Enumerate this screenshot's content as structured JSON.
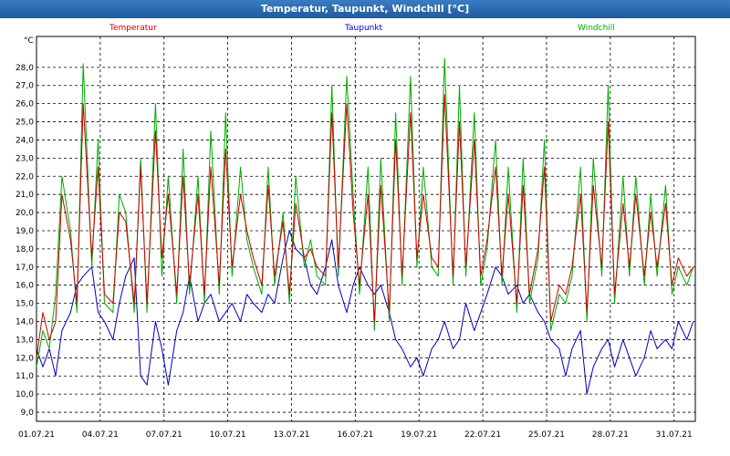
{
  "window": {
    "title": "Temperatur, Taupunkt, Windchill [°C]"
  },
  "colors": {
    "temperatur": "#cc0000",
    "taupunkt": "#0000bb",
    "windchill": "#00aa00",
    "grid": "#000000",
    "title_bar": "#2b6cb0"
  },
  "chart_data": {
    "type": "line",
    "title": "Temperatur, Taupunkt, Windchill [°C]",
    "ylabel": "°C",
    "xlabel": "",
    "ylim": [
      8.5,
      29.7
    ],
    "xlim": [
      1.0,
      32.0
    ],
    "y_ticks": [
      "9,0",
      "10,0",
      "11,0",
      "12,0",
      "13,0",
      "14,0",
      "15,0",
      "16,0",
      "17,0",
      "18,0",
      "19,0",
      "20,0",
      "21,0",
      "22,0",
      "23,0",
      "24,0",
      "25,0",
      "26,0",
      "27,0",
      "28,0"
    ],
    "x_ticks": [
      {
        "label": "01.07.21",
        "day": 1
      },
      {
        "label": "04.07.21",
        "day": 4
      },
      {
        "label": "07.07.21",
        "day": 7
      },
      {
        "label": "10.07.21",
        "day": 10
      },
      {
        "label": "13.07.21",
        "day": 13
      },
      {
        "label": "16.07.21",
        "day": 16
      },
      {
        "label": "19.07.21",
        "day": 19
      },
      {
        "label": "22.07.21",
        "day": 22
      },
      {
        "label": "25.07.21",
        "day": 25
      },
      {
        "label": "28.07.21",
        "day": 28
      },
      {
        "label": "31.07.21",
        "day": 31
      }
    ],
    "grid": true,
    "legend_position": "top",
    "x_unit": "day of July 2021",
    "series": [
      {
        "name": "Temperatur",
        "color": "#cc0000",
        "x": [
          1.0,
          1.3,
          1.6,
          1.9,
          2.2,
          2.6,
          2.9,
          3.2,
          3.6,
          3.9,
          4.2,
          4.6,
          4.9,
          5.2,
          5.6,
          5.9,
          6.2,
          6.6,
          6.9,
          7.2,
          7.6,
          7.9,
          8.2,
          8.6,
          8.9,
          9.2,
          9.6,
          9.9,
          10.2,
          10.6,
          10.9,
          11.2,
          11.6,
          11.9,
          12.2,
          12.6,
          12.9,
          13.2,
          13.6,
          13.9,
          14.2,
          14.6,
          14.9,
          15.2,
          15.6,
          15.9,
          16.2,
          16.6,
          16.9,
          17.2,
          17.6,
          17.9,
          18.2,
          18.6,
          18.9,
          19.2,
          19.6,
          19.9,
          20.2,
          20.6,
          20.9,
          21.2,
          21.6,
          21.9,
          22.2,
          22.6,
          22.9,
          23.2,
          23.6,
          23.9,
          24.2,
          24.6,
          24.9,
          25.2,
          25.6,
          25.9,
          26.2,
          26.6,
          26.9,
          27.2,
          27.6,
          27.9,
          28.2,
          28.6,
          28.9,
          29.2,
          29.6,
          29.9,
          30.2,
          30.6,
          30.9,
          31.2,
          31.6,
          31.9
        ],
        "values": [
          12.0,
          14.5,
          13.0,
          14.0,
          21.0,
          18.5,
          15.0,
          26.0,
          17.5,
          22.5,
          15.5,
          15.0,
          20.0,
          19.5,
          15.0,
          22.5,
          15.0,
          24.5,
          17.5,
          21.0,
          15.5,
          22.0,
          16.0,
          21.0,
          15.5,
          22.5,
          16.0,
          23.5,
          17.0,
          21.0,
          19.0,
          17.5,
          16.0,
          21.5,
          16.5,
          19.5,
          15.5,
          20.5,
          17.5,
          18.0,
          17.0,
          16.5,
          25.5,
          17.0,
          26.0,
          20.0,
          16.0,
          21.0,
          14.0,
          21.5,
          14.5,
          24.0,
          16.5,
          25.5,
          17.5,
          21.0,
          17.5,
          17.0,
          26.5,
          16.5,
          25.0,
          17.0,
          24.0,
          16.5,
          18.5,
          22.5,
          16.5,
          21.0,
          15.0,
          21.5,
          15.5,
          18.0,
          22.5,
          14.0,
          16.0,
          15.5,
          17.0,
          21.0,
          14.5,
          21.5,
          17.0,
          25.0,
          15.5,
          20.5,
          17.0,
          21.0,
          16.5,
          20.0,
          17.0,
          20.5,
          16.0,
          17.5,
          16.5,
          17.0
        ]
      },
      {
        "name": "Taupunkt",
        "color": "#0000bb",
        "x": [
          1.0,
          1.3,
          1.6,
          1.9,
          2.2,
          2.6,
          2.9,
          3.2,
          3.6,
          3.9,
          4.2,
          4.6,
          4.9,
          5.2,
          5.6,
          5.9,
          6.2,
          6.6,
          6.9,
          7.2,
          7.6,
          7.9,
          8.2,
          8.6,
          8.9,
          9.2,
          9.6,
          9.9,
          10.2,
          10.6,
          10.9,
          11.2,
          11.6,
          11.9,
          12.2,
          12.6,
          12.9,
          13.2,
          13.6,
          13.9,
          14.2,
          14.6,
          14.9,
          15.2,
          15.6,
          15.9,
          16.2,
          16.6,
          16.9,
          17.2,
          17.6,
          17.9,
          18.2,
          18.6,
          18.9,
          19.2,
          19.6,
          19.9,
          20.2,
          20.6,
          20.9,
          21.2,
          21.6,
          21.9,
          22.2,
          22.6,
          22.9,
          23.2,
          23.6,
          23.9,
          24.2,
          24.6,
          24.9,
          25.2,
          25.6,
          25.9,
          26.2,
          26.6,
          26.9,
          27.2,
          27.6,
          27.9,
          28.2,
          28.6,
          28.9,
          29.2,
          29.6,
          29.9,
          30.2,
          30.6,
          30.9,
          31.2,
          31.6,
          31.9
        ],
        "values": [
          12.5,
          11.5,
          12.5,
          11.0,
          13.5,
          14.5,
          16.0,
          16.5,
          17.0,
          14.5,
          14.0,
          13.0,
          15.0,
          16.5,
          17.5,
          11.0,
          10.5,
          14.0,
          12.5,
          10.5,
          13.5,
          14.5,
          16.5,
          14.0,
          15.0,
          15.5,
          14.0,
          14.5,
          15.0,
          14.0,
          15.5,
          15.0,
          14.5,
          15.5,
          15.0,
          17.5,
          19.0,
          18.0,
          17.5,
          16.0,
          15.5,
          17.0,
          18.5,
          16.0,
          14.5,
          16.0,
          17.0,
          16.0,
          15.5,
          16.0,
          14.5,
          13.0,
          12.5,
          11.5,
          12.0,
          11.0,
          12.5,
          13.0,
          14.0,
          12.5,
          13.0,
          15.0,
          13.5,
          14.5,
          15.5,
          17.0,
          16.5,
          15.5,
          16.0,
          15.0,
          15.5,
          14.5,
          14.0,
          13.0,
          12.5,
          11.0,
          12.5,
          13.5,
          10.0,
          11.5,
          12.5,
          13.0,
          11.5,
          13.0,
          12.0,
          11.0,
          12.0,
          13.5,
          12.5,
          13.0,
          12.5,
          14.0,
          13.0,
          14.0
        ]
      },
      {
        "name": "Windchill",
        "color": "#00aa00",
        "x": [
          1.0,
          1.3,
          1.6,
          1.9,
          2.2,
          2.6,
          2.9,
          3.2,
          3.6,
          3.9,
          4.2,
          4.6,
          4.9,
          5.2,
          5.6,
          5.9,
          6.2,
          6.6,
          6.9,
          7.2,
          7.6,
          7.9,
          8.2,
          8.6,
          8.9,
          9.2,
          9.6,
          9.9,
          10.2,
          10.6,
          10.9,
          11.2,
          11.6,
          11.9,
          12.2,
          12.6,
          12.9,
          13.2,
          13.6,
          13.9,
          14.2,
          14.6,
          14.9,
          15.2,
          15.6,
          15.9,
          16.2,
          16.6,
          16.9,
          17.2,
          17.6,
          17.9,
          18.2,
          18.6,
          18.9,
          19.2,
          19.6,
          19.9,
          20.2,
          20.6,
          20.9,
          21.2,
          21.6,
          21.9,
          22.2,
          22.6,
          22.9,
          23.2,
          23.6,
          23.9,
          24.2,
          24.6,
          24.9,
          25.2,
          25.6,
          25.9,
          26.2,
          26.6,
          26.9,
          27.2,
          27.6,
          27.9,
          28.2,
          28.6,
          28.9,
          29.2,
          29.6,
          29.9,
          30.2,
          30.6,
          30.9,
          31.2,
          31.6,
          31.9
        ],
        "values": [
          11.5,
          13.5,
          12.5,
          15.5,
          22.0,
          19.0,
          14.5,
          28.2,
          17.0,
          24.0,
          15.0,
          14.5,
          21.0,
          20.0,
          14.5,
          23.0,
          14.5,
          26.0,
          16.5,
          22.0,
          15.0,
          23.5,
          15.5,
          22.0,
          15.0,
          24.5,
          15.5,
          25.5,
          16.5,
          22.5,
          18.5,
          17.0,
          15.5,
          22.5,
          16.0,
          20.0,
          15.0,
          22.0,
          17.0,
          18.5,
          16.5,
          16.0,
          27.0,
          16.5,
          27.5,
          21.0,
          15.5,
          22.5,
          13.5,
          23.0,
          14.0,
          25.5,
          16.0,
          27.5,
          17.0,
          22.5,
          17.0,
          16.5,
          28.5,
          16.0,
          27.0,
          16.5,
          25.5,
          16.0,
          18.0,
          24.0,
          16.0,
          22.5,
          14.5,
          23.0,
          15.0,
          17.5,
          24.0,
          13.5,
          15.5,
          15.0,
          16.5,
          22.5,
          14.0,
          23.0,
          16.5,
          27.0,
          15.0,
          22.0,
          16.5,
          22.0,
          16.0,
          21.0,
          16.5,
          21.5,
          15.5,
          17.0,
          16.0,
          17.0
        ]
      }
    ]
  }
}
